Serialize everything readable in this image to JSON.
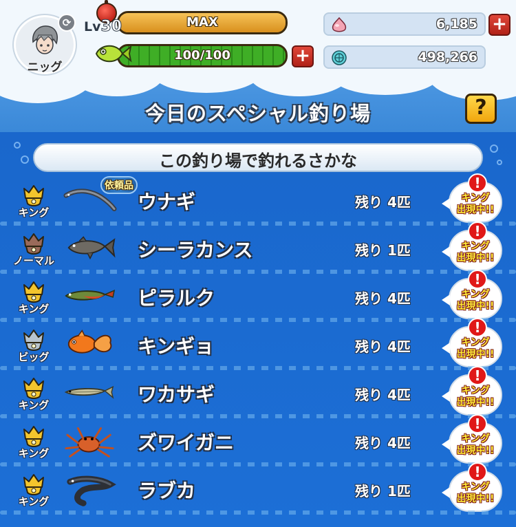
{
  "player": {
    "name": "ニッグ",
    "level_prefix": "Lv",
    "level": "30",
    "exp_label": "MAX",
    "exp_fraction": 1.0,
    "stamina_label": "100/100",
    "stamina_fraction": 1.0
  },
  "currency": {
    "gems_value": "6,185",
    "coins_value": "498,266"
  },
  "page": {
    "title": "今日のスペシャル釣り場",
    "help_label": "?"
  },
  "list": {
    "header": "この釣り場で釣れるさかな",
    "plus_label": "+",
    "king_alert_mark": "!",
    "king_text": "キング\n出現中!!",
    "items": [
      {
        "rank": "キング",
        "rank_color": "#f3c52d",
        "name": "ウナギ",
        "remaining": "残り 4匹",
        "badge": "依頼品",
        "fish_icon": "eel-icon"
      },
      {
        "rank": "ノーマル",
        "rank_color": "#9a6a5a",
        "name": "シーラカンス",
        "remaining": "残り 1匹",
        "badge": "",
        "fish_icon": "coelacanth-icon"
      },
      {
        "rank": "キング",
        "rank_color": "#f3c52d",
        "name": "ピラルク",
        "remaining": "残り 4匹",
        "badge": "",
        "fish_icon": "arapaima-icon"
      },
      {
        "rank": "ビッグ",
        "rank_color": "#b8c4cf",
        "name": "キンギョ",
        "remaining": "残り 4匹",
        "badge": "",
        "fish_icon": "goldfish-icon"
      },
      {
        "rank": "キング",
        "rank_color": "#f3c52d",
        "name": "ワカサギ",
        "remaining": "残り 4匹",
        "badge": "",
        "fish_icon": "smelt-icon"
      },
      {
        "rank": "キング",
        "rank_color": "#f3c52d",
        "name": "ズワイガニ",
        "remaining": "残り 4匹",
        "badge": "",
        "fish_icon": "crab-icon"
      },
      {
        "rank": "キング",
        "rank_color": "#f3c52d",
        "name": "ラブカ",
        "remaining": "残り 1匹",
        "badge": "",
        "fish_icon": "frilled-shark-icon"
      }
    ]
  }
}
